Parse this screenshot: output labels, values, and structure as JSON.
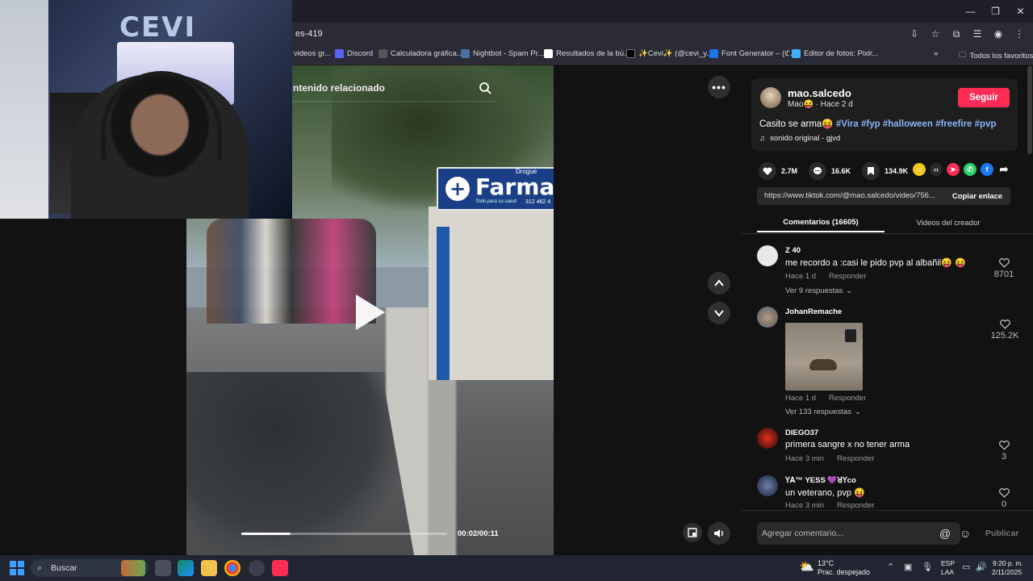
{
  "browser": {
    "url": "es-419",
    "bookmarks": [
      {
        "label": "videos gr...",
        "color": "#888888"
      },
      {
        "label": "Discord",
        "color": "#5865f2"
      },
      {
        "label": "Calculadora gráfica...",
        "color": "#555555"
      },
      {
        "label": "Nightbot - Spam Pr...",
        "color": "#4a6fa5"
      },
      {
        "label": "Resultados de la bú...",
        "color": "#ffffff"
      },
      {
        "label": "✨Cevi✨ (@cevi_y...",
        "color": "#000000"
      },
      {
        "label": "Font Generator – (ℭ...",
        "color": "#1a73e8"
      },
      {
        "label": "Editor de fotos: Pixlr...",
        "color": "#3ab0ff"
      }
    ],
    "all_bookmarks": "Todos los favoritos"
  },
  "video": {
    "search_placeholder": "ntenido relacionado",
    "timecode": "00:02/00:11",
    "progress": 0.24,
    "sign_text": "Farma",
    "sign_top": "Drogue",
    "sign_sub": "Todo para su salud",
    "sign_phone": "312 462 4"
  },
  "webcam": {
    "logo": "CEVI"
  },
  "post": {
    "username": "mao.salcedo",
    "nickname": "Mao😝",
    "time_ago": "· Hace 2 d",
    "follow_label": "Seguir",
    "caption_text": "Casito se arma😝",
    "hashtags": [
      "#Vira",
      "#fyp",
      "#halloween",
      "#freefire",
      "#pvp"
    ],
    "sound": "sonido original - gjvd",
    "likes": "2.7M",
    "comments": "16.6K",
    "saves": "134.9K",
    "link": "https://www.tiktok.com/@mao.salcedo/video/756...",
    "copy_link": "Copiar enlace",
    "tab_comments": "Comentarios (16605)",
    "tab_videos": "Videos del creador"
  },
  "comments": [
    {
      "name": "Z 40",
      "text": "me recordo a :casi le pido pvp al albañil😝 😝",
      "time": "Hace 1 d",
      "reply": "Responder",
      "replies": "Ver 9 respuestas",
      "likes": "8701"
    },
    {
      "name": "JohanRemache",
      "text": "",
      "time": "Hace 1 d",
      "reply": "Responder",
      "replies": "Ver 133 respuestas",
      "likes": "125.2K"
    },
    {
      "name": "DIEGO37",
      "text": "primera sangre x no tener arma",
      "time": "Hace 3 min",
      "reply": "Responder",
      "likes": "3"
    },
    {
      "name": "ꓬꓮ™ YESS 💜ꓤꓬco",
      "text": "un veterano, pvp 😝",
      "time": "Hace 3 min",
      "reply": "Responder",
      "likes": "0"
    }
  ],
  "composer": {
    "placeholder": "Agregar comentario...",
    "publish": "Publicar"
  },
  "taskbar": {
    "search": "Buscar",
    "temp": "13°C",
    "condition": "Prac. despejado",
    "lang1": "ESP",
    "lang2": "LAA",
    "time": "9:20 p. m.",
    "date": "2/11/2025"
  },
  "colors": {
    "accent": "#fe2c55",
    "hashtag": "#8ab4f8"
  }
}
